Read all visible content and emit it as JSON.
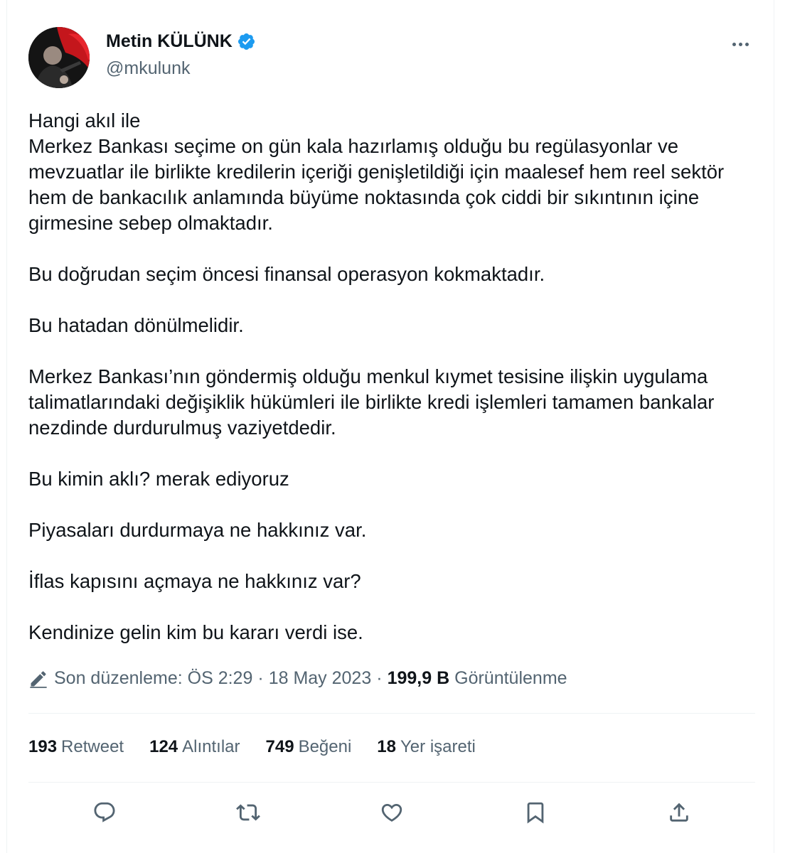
{
  "author": {
    "display_name": "Metin KÜLÜNK",
    "handle": "@mkulunk",
    "verified_icon": "verified-badge-icon",
    "badge_color": "#1d9bf0"
  },
  "tweet": {
    "paragraphs": [
      "Hangi akıl ile\nMerkez Bankası seçime on gün kala hazırlamış olduğu bu regülasyonlar ve mevzuatlar ile birlikte kredilerin içeriği genişletildiği için maalesef hem reel sektör hem de bankacılık anlamında büyüme noktasında çok ciddi bir sıkıntının içine girmesine sebep olmaktadır.",
      "Bu doğrudan seçim öncesi finansal operasyon kokmaktadır.",
      "Bu hatadan dönülmelidir.",
      "Merkez Bankası’nın göndermiş olduğu menkul kıymet tesisine ilişkin uygulama talimatlarındaki değişiklik hükümleri ile birlikte kredi işlemleri tamamen bankalar nezdinde durdurulmuş vaziyetdedir.",
      "Bu kimin aklı? merak ediyoruz",
      "Piyasaları durdurmaya ne hakkınız var.",
      "İflas kapısını açmaya ne hakkınız var?",
      "Kendinize gelin kim bu kararı verdi ise."
    ]
  },
  "meta": {
    "edited_label": "Son düzenleme: ÖS 2:29",
    "separator": "·",
    "date": "18 May 2023",
    "views_count": "199,9 B",
    "views_label": "Görüntülenme"
  },
  "stats": {
    "retweets_count": "193",
    "retweets_label": "Retweet",
    "quotes_count": "124",
    "quotes_label": "Alıntılar",
    "likes_count": "749",
    "likes_label": "Beğeni",
    "bookmarks_count": "18",
    "bookmarks_label": "Yer işareti"
  },
  "actions": [
    "reply-icon",
    "retweet-icon",
    "like-icon",
    "bookmark-icon",
    "share-icon"
  ],
  "colors": {
    "text_primary": "#0f1419",
    "text_secondary": "#536471",
    "divider": "#eff3f4"
  }
}
